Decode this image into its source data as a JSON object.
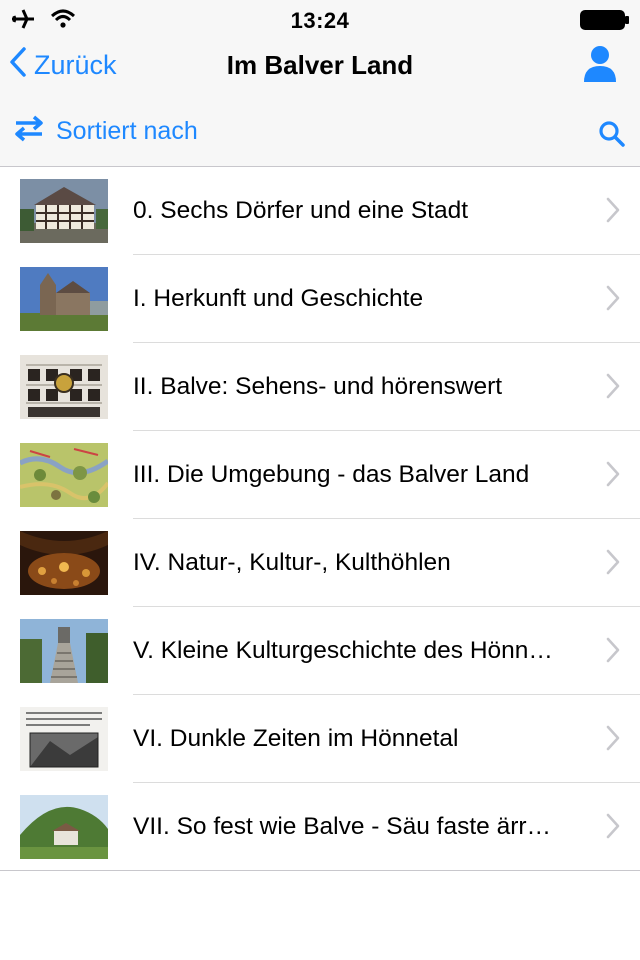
{
  "status_bar": {
    "time": "13:24"
  },
  "nav": {
    "back_label": "Zurück",
    "title": "Im Balver Land"
  },
  "toolbar": {
    "sort_label": "Sortiert nach"
  },
  "accent_color": "#1e88ff",
  "icons": [
    "airplane-icon",
    "wifi-icon",
    "battery-icon",
    "chevron-left-icon",
    "user-icon",
    "swap-arrows-icon",
    "search-icon",
    "chevron-right-icon"
  ],
  "chapters": [
    {
      "title": "0. Sechs Dörfer und eine Stadt"
    },
    {
      "title": "I. Herkunft und Geschichte"
    },
    {
      "title": "II. Balve: Sehens- und hörenswert"
    },
    {
      "title": "III. Die Umgebung - das Balver Land"
    },
    {
      "title": "IV. Natur-, Kultur-, Kulthöhlen"
    },
    {
      "title": "V. Kleine Kulturgeschichte des Hönn…"
    },
    {
      "title": "VI. Dunkle Zeiten im Hönnetal"
    },
    {
      "title": "VII. So fest wie Balve - Säu faste ärr…"
    }
  ]
}
